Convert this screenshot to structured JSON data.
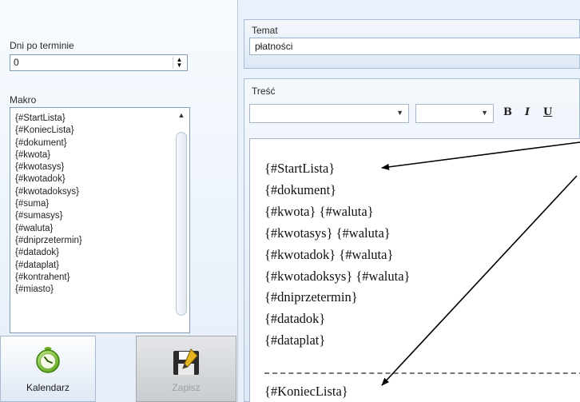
{
  "left": {
    "days_label": "Dni po terminie",
    "days_value": "0",
    "macro_label": "Makro",
    "macros": [
      "{#StartLista}",
      "{#KoniecLista}",
      "{#dokument}",
      "{#kwota}",
      "{#kwotasys}",
      "{#kwotadok}",
      "{#kwotadoksys}",
      "{#suma}",
      "{#sumasys}",
      "{#waluta}",
      "{#dniprzetermin}",
      "{#datadok}",
      "{#dataplat}",
      "{#kontrahent}",
      "{#miasto}"
    ],
    "calendar_label": "Kalendarz",
    "save_label": "Zapisz"
  },
  "right": {
    "subject_label": "Temat",
    "subject_value": "płatności",
    "body_label": "Treść",
    "bold": "B",
    "italic": "I",
    "underline": "U",
    "editor_lines": [
      "{#StartLista}",
      "{#dokument}",
      "{#kwota} {#waluta}",
      "{#kwotasys} {#waluta}",
      "{#kwotadok} {#waluta}",
      "{#kwotadoksys} {#waluta}",
      "{#dniprzetermin}",
      "{#datadok}",
      "{#dataplat}"
    ],
    "editor_last": "{#KoniecLista}"
  },
  "icons": {
    "calendar": "clock-icon",
    "save": "floppy-disk-icon"
  }
}
